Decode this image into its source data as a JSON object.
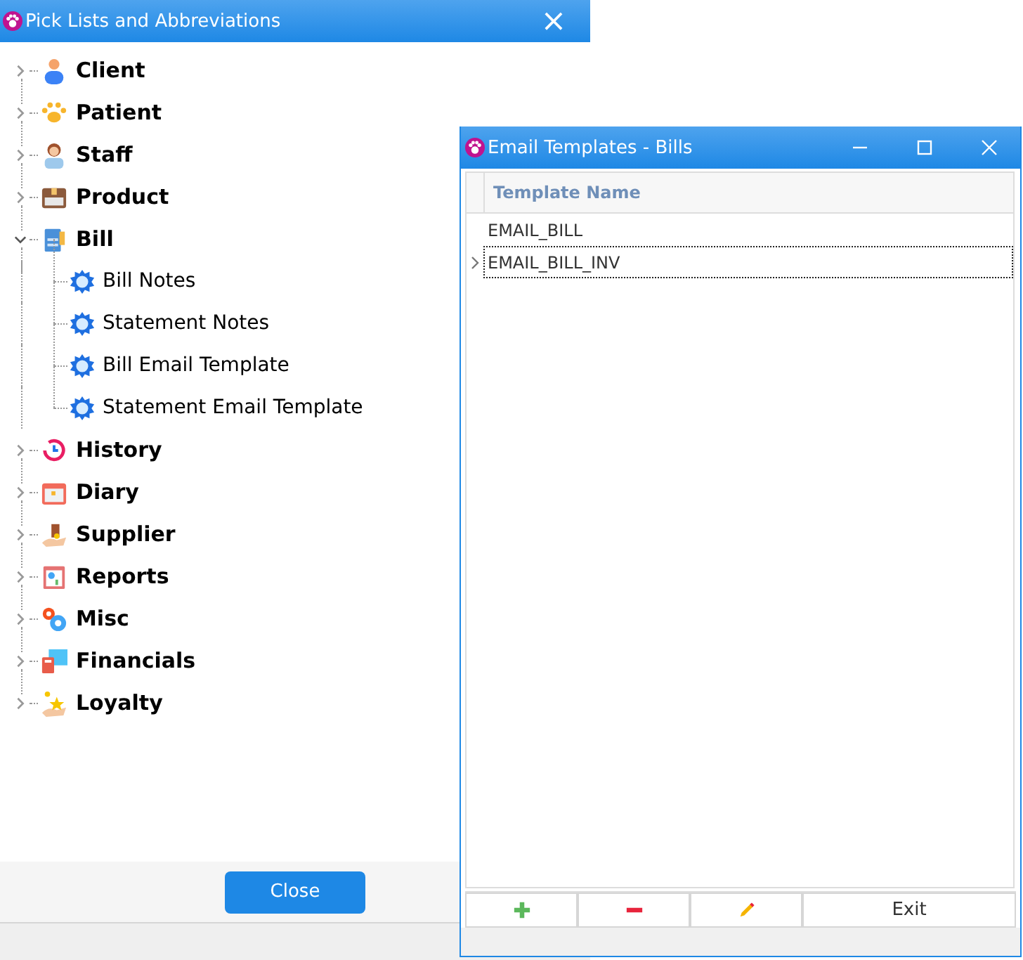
{
  "main_window": {
    "title": "Pick Lists and Abbreviations",
    "close_button": "×"
  },
  "tree": [
    {
      "label": "Client",
      "expanded": false
    },
    {
      "label": "Patient",
      "expanded": false
    },
    {
      "label": "Staff",
      "expanded": false
    },
    {
      "label": "Product",
      "expanded": false
    },
    {
      "label": "Bill",
      "expanded": true,
      "children": [
        {
          "label": "Bill Notes"
        },
        {
          "label": "Statement Notes"
        },
        {
          "label": "Bill Email Template"
        },
        {
          "label": "Statement Email Template"
        }
      ]
    },
    {
      "label": "History",
      "expanded": false
    },
    {
      "label": "Diary",
      "expanded": false
    },
    {
      "label": "Supplier",
      "expanded": false
    },
    {
      "label": "Reports",
      "expanded": false
    },
    {
      "label": "Misc",
      "expanded": false
    },
    {
      "label": "Financials",
      "expanded": false
    },
    {
      "label": "Loyalty",
      "expanded": false
    }
  ],
  "close_button": "Close",
  "dialog": {
    "title": "Email Templates - Bills",
    "table": {
      "columns": [
        "Template Name"
      ],
      "rows": [
        {
          "cells": [
            "EMAIL_BILL"
          ],
          "selected": false
        },
        {
          "cells": [
            "EMAIL_BILL_INV"
          ],
          "selected": true
        }
      ]
    },
    "buttons": [
      {
        "kind": "add"
      },
      {
        "kind": "remove"
      },
      {
        "kind": "edit"
      },
      {
        "kind": "text",
        "label": "Exit"
      }
    ]
  }
}
